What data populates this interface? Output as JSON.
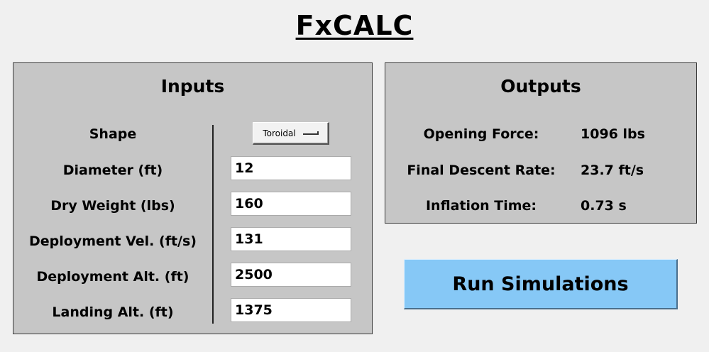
{
  "app": {
    "title": "FxCALC"
  },
  "inputs": {
    "title": "Inputs",
    "shape": {
      "label": "Shape",
      "value": "Toroidal"
    },
    "diameter": {
      "label": "Diameter (ft)",
      "value": "12"
    },
    "dry_weight": {
      "label": "Dry Weight (lbs)",
      "value": "160"
    },
    "deployment_vel": {
      "label": "Deployment Vel. (ft/s)",
      "value": "131"
    },
    "deployment_alt": {
      "label": "Deployment Alt. (ft)",
      "value": "2500"
    },
    "landing_alt": {
      "label": "Landing Alt. (ft)",
      "value": "1375"
    }
  },
  "outputs": {
    "title": "Outputs",
    "opening_force": {
      "label": "Opening Force:",
      "value": "1096 lbs"
    },
    "final_descent_rate": {
      "label": "Final Descent Rate:",
      "value": "23.7 ft/s"
    },
    "inflation_time": {
      "label": "Inflation Time:",
      "value": "0.73 s"
    }
  },
  "run_button": {
    "label": "Run Simulations"
  },
  "colors": {
    "background": "#f0f0f0",
    "panel": "#c6c6c6",
    "run_button": "#86c8f6"
  }
}
